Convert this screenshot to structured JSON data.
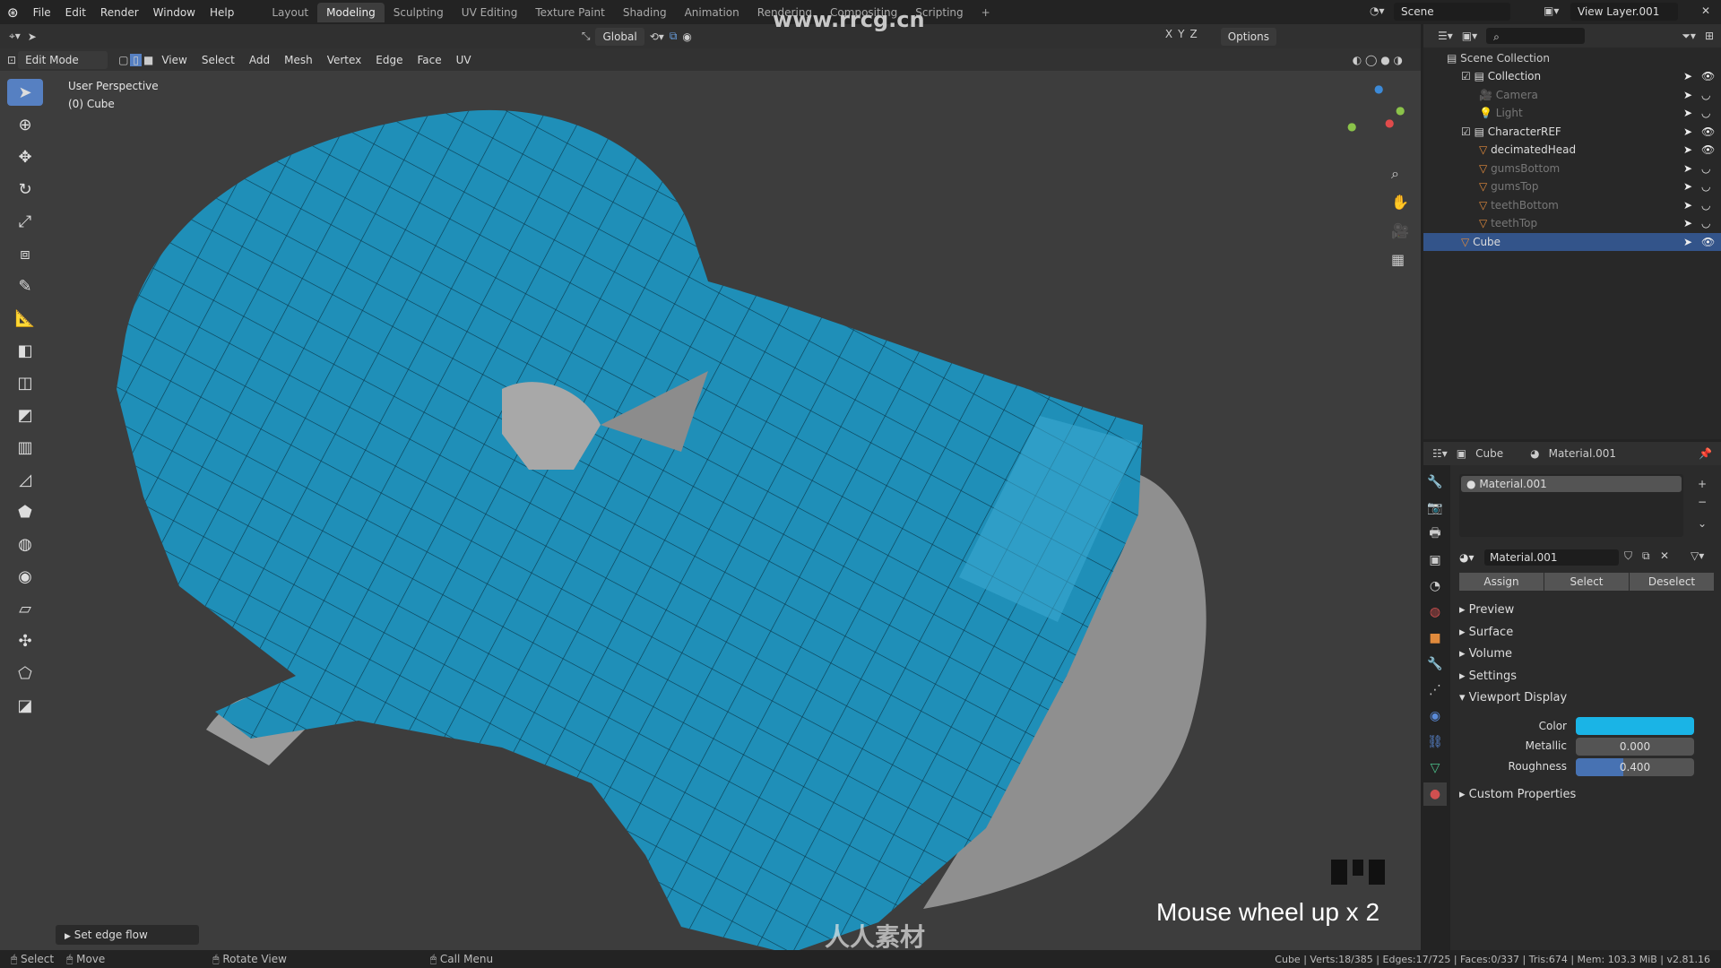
{
  "topbar": {
    "menus": [
      "File",
      "Edit",
      "Render",
      "Window",
      "Help"
    ],
    "workspaces": [
      "Layout",
      "Modeling",
      "Sculpting",
      "UV Editing",
      "Texture Paint",
      "Shading",
      "Animation",
      "Rendering",
      "Compositing",
      "Scripting"
    ],
    "active_workspace": "Modeling",
    "add_tab": "+",
    "scene": "Scene",
    "view_layer": "View Layer.001"
  },
  "header": {
    "orientation": "Global",
    "axes": [
      "X",
      "Y",
      "Z"
    ],
    "options": "Options"
  },
  "viewport_header": {
    "mode": "Edit Mode",
    "menus": [
      "View",
      "Select",
      "Add",
      "Mesh",
      "Vertex",
      "Edge",
      "Face",
      "UV"
    ]
  },
  "viewport": {
    "perspective": "User Perspective",
    "object": "(0) Cube",
    "operator_panel": "Set edge flow",
    "overlay_text": "Mouse wheel up x 2",
    "watermark": "www.rrcg.cn",
    "logo_text": "人人素材",
    "mesh_color": "#1f8fb8"
  },
  "outliner": {
    "search_placeholder": "",
    "root": "Scene Collection",
    "items": [
      {
        "label": "Collection",
        "type": "collection",
        "depth": 1
      },
      {
        "label": "Camera",
        "type": "camera",
        "depth": 2
      },
      {
        "label": "Light",
        "type": "light",
        "depth": 2
      },
      {
        "label": "CharacterREF",
        "type": "collection",
        "depth": 1
      },
      {
        "label": "decimatedHead",
        "type": "mesh",
        "depth": 2
      },
      {
        "label": "gumsBottom",
        "type": "mesh",
        "depth": 2
      },
      {
        "label": "gumsTop",
        "type": "mesh",
        "depth": 2
      },
      {
        "label": "teethBottom",
        "type": "mesh",
        "depth": 2
      },
      {
        "label": "teethTop",
        "type": "mesh",
        "depth": 2
      },
      {
        "label": "Cube",
        "type": "mesh",
        "depth": 1,
        "selected": true
      }
    ]
  },
  "properties": {
    "object": "Cube",
    "material": "Material.001",
    "slot": "Material.001",
    "material_field": "Material.001",
    "buttons": [
      "Assign",
      "Select",
      "Deselect"
    ],
    "sections": [
      "Preview",
      "Surface",
      "Volume",
      "Settings",
      "Viewport Display"
    ],
    "viewport_display": {
      "color_label": "Color",
      "color": "#1ab4e6",
      "metallic_label": "Metallic",
      "metallic": "0.000",
      "roughness_label": "Roughness",
      "roughness": "0.400",
      "roughness_fraction": 0.4
    },
    "custom_properties": "Custom Properties"
  },
  "status": {
    "hints": [
      "Select",
      "Move",
      "Rotate View",
      "Call Menu"
    ],
    "stats": "Cube | Verts:18/385 | Edges:17/725 | Faces:0/337 | Tris:674 | Mem: 103.3 MiB | v2.81.16"
  }
}
